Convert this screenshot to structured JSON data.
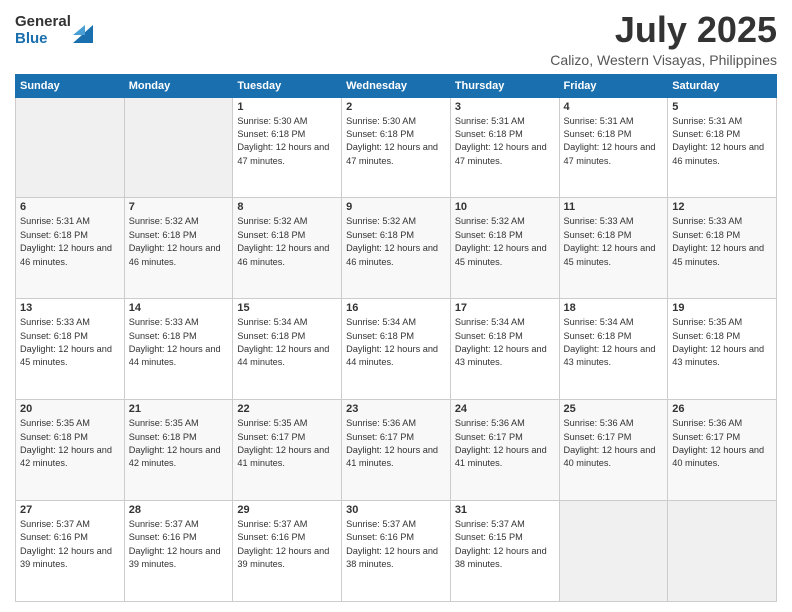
{
  "logo": {
    "general": "General",
    "blue": "Blue"
  },
  "header": {
    "month": "July 2025",
    "location": "Calizo, Western Visayas, Philippines"
  },
  "weekdays": [
    "Sunday",
    "Monday",
    "Tuesday",
    "Wednesday",
    "Thursday",
    "Friday",
    "Saturday"
  ],
  "weeks": [
    [
      {
        "day": "",
        "empty": true
      },
      {
        "day": "",
        "empty": true
      },
      {
        "day": "1",
        "sunrise": "Sunrise: 5:30 AM",
        "sunset": "Sunset: 6:18 PM",
        "daylight": "Daylight: 12 hours and 47 minutes."
      },
      {
        "day": "2",
        "sunrise": "Sunrise: 5:30 AM",
        "sunset": "Sunset: 6:18 PM",
        "daylight": "Daylight: 12 hours and 47 minutes."
      },
      {
        "day": "3",
        "sunrise": "Sunrise: 5:31 AM",
        "sunset": "Sunset: 6:18 PM",
        "daylight": "Daylight: 12 hours and 47 minutes."
      },
      {
        "day": "4",
        "sunrise": "Sunrise: 5:31 AM",
        "sunset": "Sunset: 6:18 PM",
        "daylight": "Daylight: 12 hours and 47 minutes."
      },
      {
        "day": "5",
        "sunrise": "Sunrise: 5:31 AM",
        "sunset": "Sunset: 6:18 PM",
        "daylight": "Daylight: 12 hours and 46 minutes."
      }
    ],
    [
      {
        "day": "6",
        "sunrise": "Sunrise: 5:31 AM",
        "sunset": "Sunset: 6:18 PM",
        "daylight": "Daylight: 12 hours and 46 minutes."
      },
      {
        "day": "7",
        "sunrise": "Sunrise: 5:32 AM",
        "sunset": "Sunset: 6:18 PM",
        "daylight": "Daylight: 12 hours and 46 minutes."
      },
      {
        "day": "8",
        "sunrise": "Sunrise: 5:32 AM",
        "sunset": "Sunset: 6:18 PM",
        "daylight": "Daylight: 12 hours and 46 minutes."
      },
      {
        "day": "9",
        "sunrise": "Sunrise: 5:32 AM",
        "sunset": "Sunset: 6:18 PM",
        "daylight": "Daylight: 12 hours and 46 minutes."
      },
      {
        "day": "10",
        "sunrise": "Sunrise: 5:32 AM",
        "sunset": "Sunset: 6:18 PM",
        "daylight": "Daylight: 12 hours and 45 minutes."
      },
      {
        "day": "11",
        "sunrise": "Sunrise: 5:33 AM",
        "sunset": "Sunset: 6:18 PM",
        "daylight": "Daylight: 12 hours and 45 minutes."
      },
      {
        "day": "12",
        "sunrise": "Sunrise: 5:33 AM",
        "sunset": "Sunset: 6:18 PM",
        "daylight": "Daylight: 12 hours and 45 minutes."
      }
    ],
    [
      {
        "day": "13",
        "sunrise": "Sunrise: 5:33 AM",
        "sunset": "Sunset: 6:18 PM",
        "daylight": "Daylight: 12 hours and 45 minutes."
      },
      {
        "day": "14",
        "sunrise": "Sunrise: 5:33 AM",
        "sunset": "Sunset: 6:18 PM",
        "daylight": "Daylight: 12 hours and 44 minutes."
      },
      {
        "day": "15",
        "sunrise": "Sunrise: 5:34 AM",
        "sunset": "Sunset: 6:18 PM",
        "daylight": "Daylight: 12 hours and 44 minutes."
      },
      {
        "day": "16",
        "sunrise": "Sunrise: 5:34 AM",
        "sunset": "Sunset: 6:18 PM",
        "daylight": "Daylight: 12 hours and 44 minutes."
      },
      {
        "day": "17",
        "sunrise": "Sunrise: 5:34 AM",
        "sunset": "Sunset: 6:18 PM",
        "daylight": "Daylight: 12 hours and 43 minutes."
      },
      {
        "day": "18",
        "sunrise": "Sunrise: 5:34 AM",
        "sunset": "Sunset: 6:18 PM",
        "daylight": "Daylight: 12 hours and 43 minutes."
      },
      {
        "day": "19",
        "sunrise": "Sunrise: 5:35 AM",
        "sunset": "Sunset: 6:18 PM",
        "daylight": "Daylight: 12 hours and 43 minutes."
      }
    ],
    [
      {
        "day": "20",
        "sunrise": "Sunrise: 5:35 AM",
        "sunset": "Sunset: 6:18 PM",
        "daylight": "Daylight: 12 hours and 42 minutes."
      },
      {
        "day": "21",
        "sunrise": "Sunrise: 5:35 AM",
        "sunset": "Sunset: 6:18 PM",
        "daylight": "Daylight: 12 hours and 42 minutes."
      },
      {
        "day": "22",
        "sunrise": "Sunrise: 5:35 AM",
        "sunset": "Sunset: 6:17 PM",
        "daylight": "Daylight: 12 hours and 41 minutes."
      },
      {
        "day": "23",
        "sunrise": "Sunrise: 5:36 AM",
        "sunset": "Sunset: 6:17 PM",
        "daylight": "Daylight: 12 hours and 41 minutes."
      },
      {
        "day": "24",
        "sunrise": "Sunrise: 5:36 AM",
        "sunset": "Sunset: 6:17 PM",
        "daylight": "Daylight: 12 hours and 41 minutes."
      },
      {
        "day": "25",
        "sunrise": "Sunrise: 5:36 AM",
        "sunset": "Sunset: 6:17 PM",
        "daylight": "Daylight: 12 hours and 40 minutes."
      },
      {
        "day": "26",
        "sunrise": "Sunrise: 5:36 AM",
        "sunset": "Sunset: 6:17 PM",
        "daylight": "Daylight: 12 hours and 40 minutes."
      }
    ],
    [
      {
        "day": "27",
        "sunrise": "Sunrise: 5:37 AM",
        "sunset": "Sunset: 6:16 PM",
        "daylight": "Daylight: 12 hours and 39 minutes."
      },
      {
        "day": "28",
        "sunrise": "Sunrise: 5:37 AM",
        "sunset": "Sunset: 6:16 PM",
        "daylight": "Daylight: 12 hours and 39 minutes."
      },
      {
        "day": "29",
        "sunrise": "Sunrise: 5:37 AM",
        "sunset": "Sunset: 6:16 PM",
        "daylight": "Daylight: 12 hours and 39 minutes."
      },
      {
        "day": "30",
        "sunrise": "Sunrise: 5:37 AM",
        "sunset": "Sunset: 6:16 PM",
        "daylight": "Daylight: 12 hours and 38 minutes."
      },
      {
        "day": "31",
        "sunrise": "Sunrise: 5:37 AM",
        "sunset": "Sunset: 6:15 PM",
        "daylight": "Daylight: 12 hours and 38 minutes."
      },
      {
        "day": "",
        "empty": true
      },
      {
        "day": "",
        "empty": true
      }
    ]
  ]
}
